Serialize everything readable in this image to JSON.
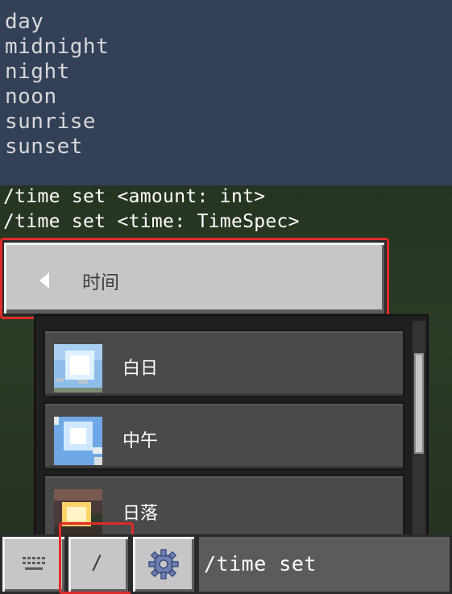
{
  "suggestions": [
    "day",
    "midnight",
    "night",
    "noon",
    "sunrise",
    "sunset"
  ],
  "syntax_hints": [
    "/time set <amount: int>",
    "/time set <time: TimeSpec>"
  ],
  "category": {
    "title": "时间",
    "back_icon": "back-arrow-icon"
  },
  "presets": [
    {
      "label": "白日",
      "icon": "day-sky-icon"
    },
    {
      "label": "中午",
      "icon": "noon-sky-icon"
    },
    {
      "label": "日落",
      "icon": "sunset-sky-icon"
    }
  ],
  "toolbar": {
    "keyboard_icon": "keyboard-icon",
    "slash_label": "/",
    "settings_icon": "gear-icon"
  },
  "command_input": {
    "value": "/time set"
  },
  "colors": {
    "highlight": "#e02a2a",
    "button_face": "#c6c6c6",
    "panel_item": "#4a4a4a",
    "sky_background": "#324058"
  }
}
